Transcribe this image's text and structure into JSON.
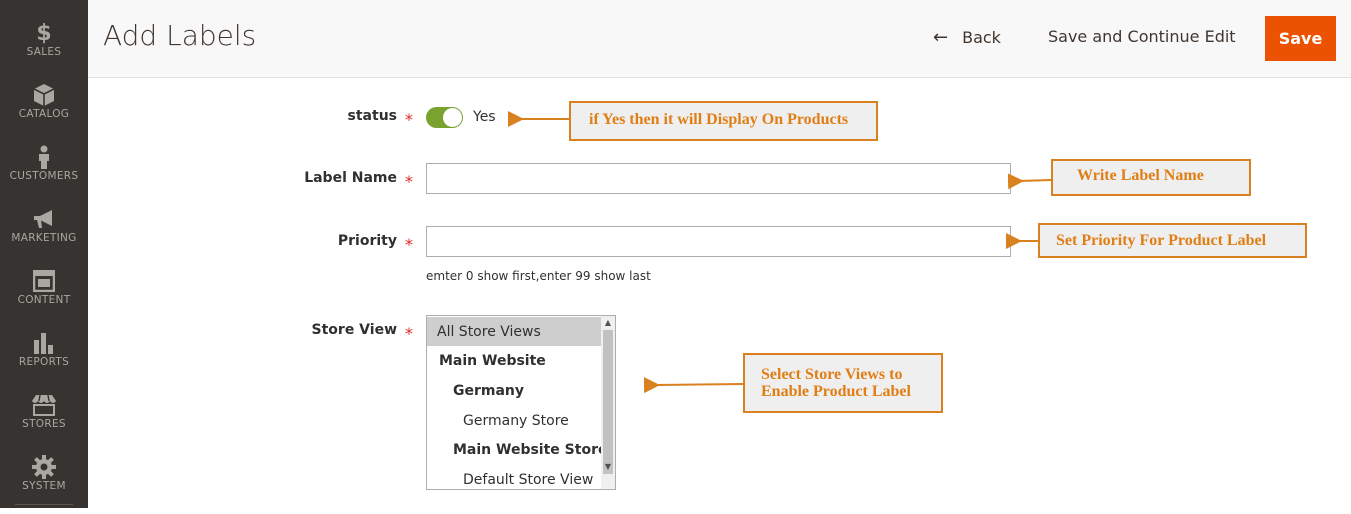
{
  "sidebar": {
    "items": [
      {
        "label": "SALES",
        "icon": "dollar-icon"
      },
      {
        "label": "CATALOG",
        "icon": "box-icon"
      },
      {
        "label": "CUSTOMERS",
        "icon": "person-icon"
      },
      {
        "label": "MARKETING",
        "icon": "megaphone-icon"
      },
      {
        "label": "CONTENT",
        "icon": "layout-icon"
      },
      {
        "label": "REPORTS",
        "icon": "bar-chart-icon"
      },
      {
        "label": "STORES",
        "icon": "storefront-icon"
      },
      {
        "label": "SYSTEM",
        "icon": "gear-icon"
      }
    ],
    "dollar_glyph": "$"
  },
  "header": {
    "title": "Add Labels",
    "back_arrow": "←",
    "back_label": "Back",
    "save_continue_label": "Save and Continue Edit",
    "save_label": "Save"
  },
  "form": {
    "status": {
      "label": "status",
      "required_mark": "*",
      "toggle_text": "Yes",
      "enabled": true
    },
    "label_name": {
      "label": "Label Name",
      "required_mark": "*",
      "value": ""
    },
    "priority": {
      "label": "Priority",
      "required_mark": "*",
      "value": "",
      "note": "emter 0 show first,enter 99 show last"
    },
    "store_view": {
      "label": "Store View",
      "required_mark": "*",
      "options": [
        {
          "text": "All Store Views",
          "selected": true
        },
        {
          "text": "Main Website"
        },
        {
          "text": "Germany"
        },
        {
          "text": "Germany Store"
        },
        {
          "text": "Main Website Store"
        },
        {
          "text": "Default Store View"
        }
      ],
      "scroll_up": "▲",
      "scroll_down": "▼"
    }
  },
  "annotations": {
    "status": "if Yes then it will Display On Products",
    "label_name": "Write Label Name",
    "priority": "Set Priority For Product Label",
    "store_view_line1": "Select Store Views to",
    "store_view_line2": "Enable Product Label"
  },
  "colors": {
    "sidebar_bg": "#373330",
    "accent": "#eb5202",
    "toggle_on": "#79a22e",
    "annotation": "#e07e16",
    "required": "#e22626"
  }
}
